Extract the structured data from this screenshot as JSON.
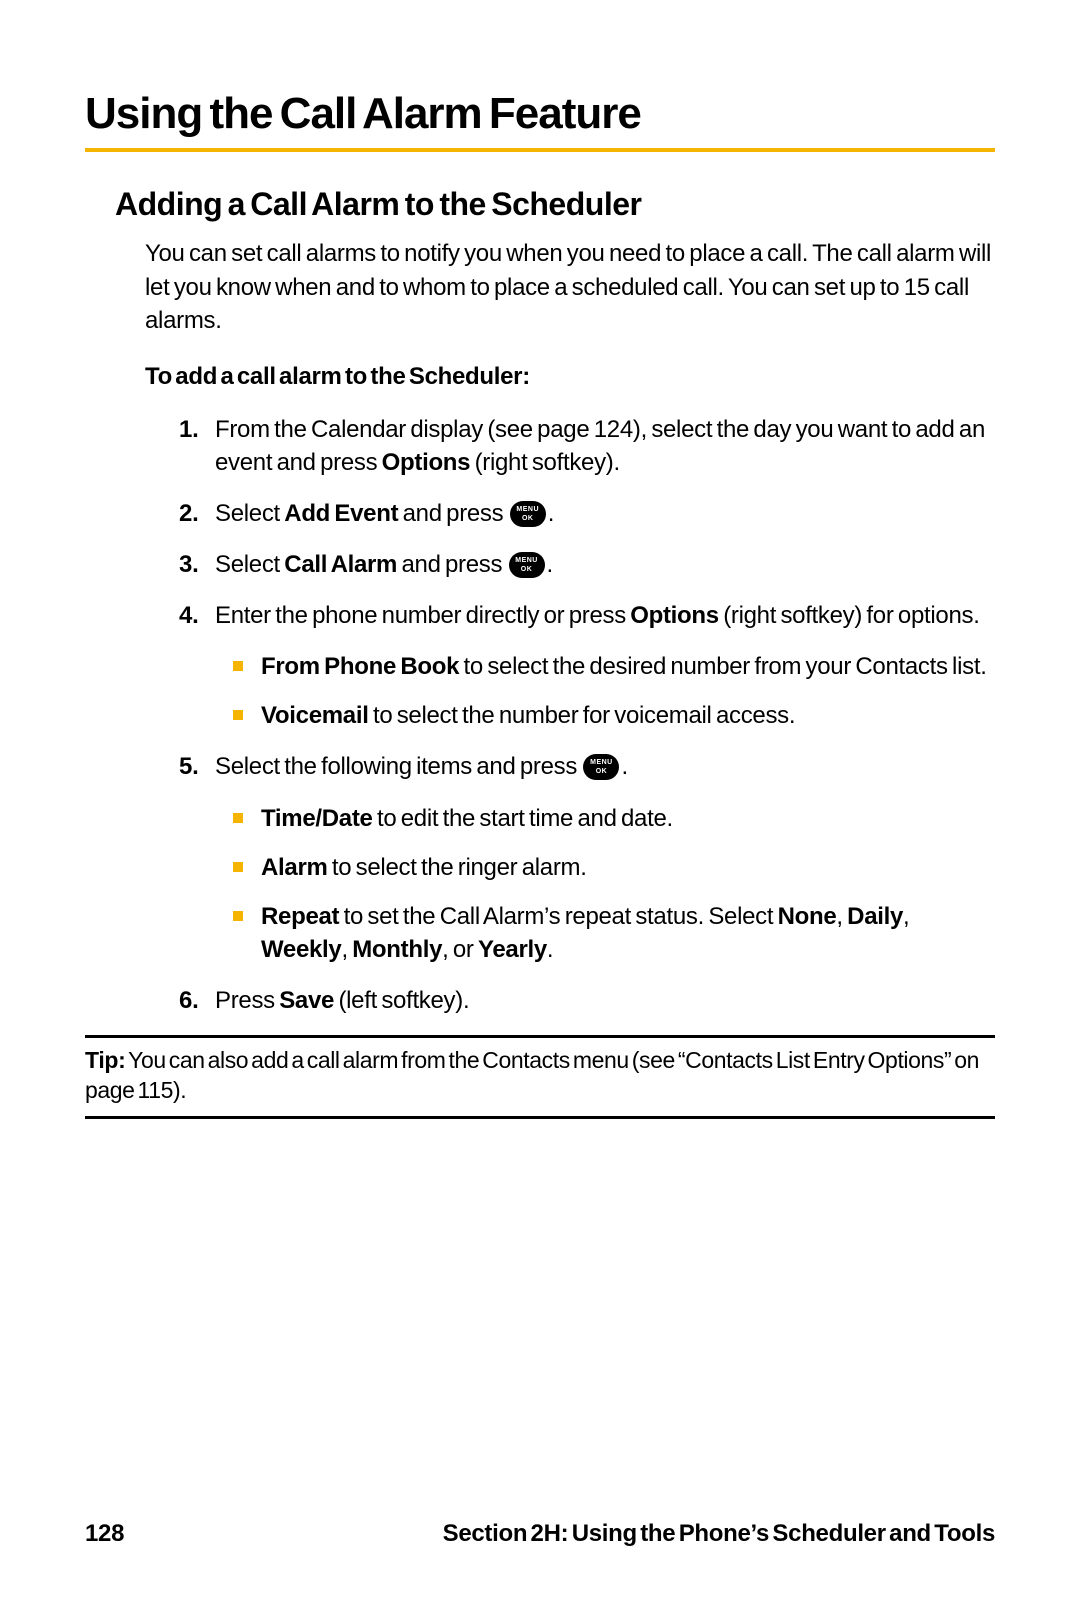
{
  "title": "Using the Call Alarm Feature",
  "subtitle": "Adding a Call Alarm to the Scheduler",
  "intro": "You can set call alarms to notify you when you need to place a call. The call alarm will let you know when and to whom to place a scheduled call. You can set up to 15 call alarms.",
  "lead": "To add a call alarm to the Scheduler:",
  "icon": {
    "t1": "MENU",
    "t2": "OK"
  },
  "steps": {
    "s1_a": "From the Calendar display (see page 124), select the day you want to add an event and press ",
    "s1_b": "Options",
    "s1_c": " (right softkey).",
    "s2_a": "Select ",
    "s2_b": "Add Event",
    "s2_c": " and press ",
    "s3_a": "Select ",
    "s3_b": "Call Alarm",
    "s3_c": " and press ",
    "s4_a": "Enter the phone number directly or press ",
    "s4_b": "Options",
    "s4_c": " (right softkey) for options.",
    "s4_sub": {
      "i1_b": "From Phone Book",
      "i1_t": " to select the desired number from your Contacts list.",
      "i2_b": "Voicemail",
      "i2_t": " to select the number for voicemail access."
    },
    "s5_a": "Select the following items and press ",
    "s5_sub": {
      "i1_b": "Time/Date",
      "i1_t": " to edit the start time and date.",
      "i2_b": "Alarm",
      "i2_t": " to select the ringer alarm.",
      "i3_b": "Repeat",
      "i3_t1": " to set the Call Alarm’s repeat status. Select ",
      "i3_t2": "None",
      "i3_t3": ", ",
      "i3_t4": "Daily",
      "i3_t5": ", ",
      "i3_t6": "Weekly",
      "i3_t7": ", ",
      "i3_t8": "Monthly",
      "i3_t9": ", or ",
      "i3_t10": "Yearly",
      "i3_t11": "."
    },
    "s6_a": "Press ",
    "s6_b": "Save",
    "s6_c": " (left softkey)."
  },
  "tip": {
    "label": "Tip:",
    "text": " You can also add a call alarm from the Contacts menu (see “Contacts List Entry Options” on page 115)."
  },
  "footer": {
    "page": "128",
    "section": "Section 2H: Using the Phone’s Scheduler and Tools"
  }
}
